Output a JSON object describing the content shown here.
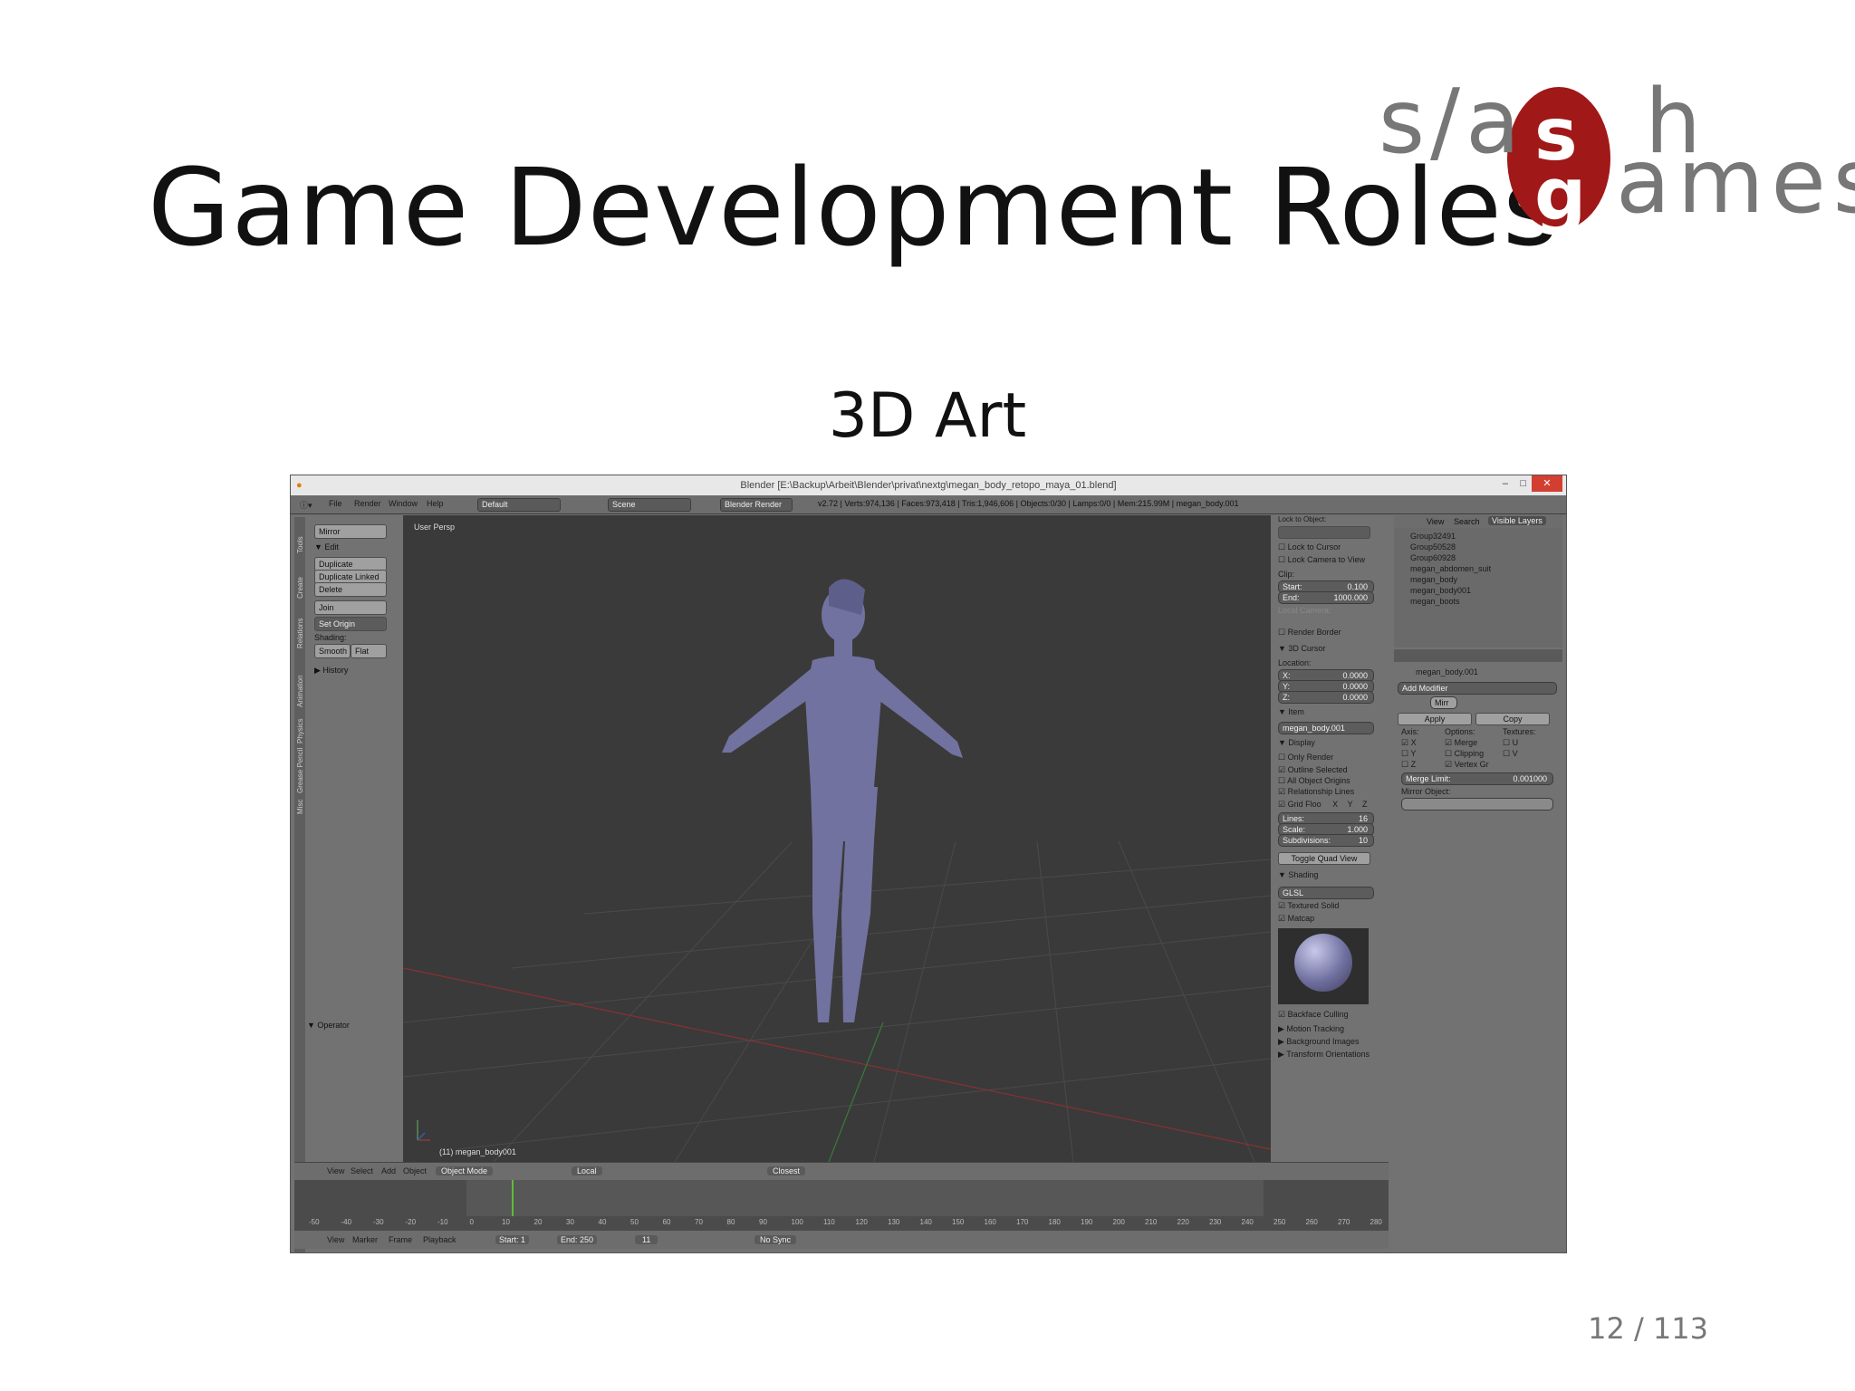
{
  "slide": {
    "title": "Game Development Roles",
    "subtitle": "3D Art",
    "page": "12 / 113",
    "logo": {
      "line1": "s/a",
      "line1b": "h",
      "line2": "ames",
      "mark_top": "s",
      "mark_bottom": "g",
      "mark_color": "#a01818"
    }
  },
  "blender": {
    "window_title": "Blender [E:\\Backup\\Arbeit\\Blender\\privat\\nextg\\megan_body_retopo_maya_01.blend]",
    "menu": [
      "File",
      "Render",
      "Window",
      "Help"
    ],
    "layout": "Default",
    "scene": "Scene",
    "engine": "Blender Render",
    "stats": "v2.72 | Verts:974,136 | Faces:973,418 | Tris:1,946,606 | Objects:0/30 | Lamps:0/0 | Mem:215.99M | megan_body.001",
    "toolshelf": {
      "mirror": "Mirror",
      "edit_header": "▼ Edit",
      "duplicate": "Duplicate",
      "duplicate_linked": "Duplicate Linked",
      "delete": "Delete",
      "join": "Join",
      "set_origin": "Set Origin",
      "shading": "Shading:",
      "smooth": "Smooth",
      "flat": "Flat",
      "history": "▶ History",
      "operator": "▼ Operator",
      "tabs": [
        "Tools",
        "Create",
        "Relations",
        "Animation",
        "Physics",
        "Grease Pencil",
        "Misc"
      ]
    },
    "viewport": {
      "label": "User Persp",
      "object_label": "(11) megan_body001"
    },
    "right_panel": {
      "lock_object": "Lock to Object:",
      "lock_cursor": "Lock to Cursor",
      "lock_camera": "Lock Camera to View",
      "clip": "Clip:",
      "clip_start": "Start:",
      "clip_start_val": "0.100",
      "clip_end": "End:",
      "clip_end_val": "1000.000",
      "local_camera": "Local Camera:",
      "render_border": "Render Border",
      "cursor_header": "▼ 3D Cursor",
      "location": "Location:",
      "x": "X:",
      "x_val": "0.0000",
      "y": "Y:",
      "y_val": "0.0000",
      "z": "Z:",
      "z_val": "0.0000",
      "item_header": "▼ Item",
      "item_name": "megan_body.001",
      "display_header": "▼ Display",
      "only_render": "Only Render",
      "outline_selected": "Outline Selected",
      "all_origins": "All Object Origins",
      "relationship_lines": "Relationship Lines",
      "grid_floor": "Grid Floo",
      "axis_x": "X",
      "axis_y": "Y",
      "axis_z": "Z",
      "lines": "Lines:",
      "lines_val": "16",
      "scale": "Scale:",
      "scale_val": "1.000",
      "subdivisions": "Subdivisions:",
      "subdivisions_val": "10",
      "toggle_quad": "Toggle Quad View",
      "shading_header": "▼ Shading",
      "shading_mode": "GLSL",
      "textured_solid": "Textured Solid",
      "matcap": "Matcap",
      "backface_culling": "Backface Culling",
      "motion_tracking": "▶ Motion Tracking",
      "background_images": "▶ Background Images",
      "transform_orientations": "▶ Transform Orientations"
    },
    "outliner": {
      "tabs": [
        "View",
        "Search",
        "Visible Layers"
      ],
      "items": [
        "Group32491",
        "Group50528",
        "Group60928",
        "megan_abdomen_suit",
        "megan_body",
        "megan_body001",
        "megan_boots"
      ]
    },
    "properties": {
      "object_path": "megan_body.001",
      "add_modifier": "Add Modifier",
      "modifier_name": "Mirr",
      "apply": "Apply",
      "copy": "Copy",
      "axis": "Axis:",
      "options": "Options:",
      "textures": "Textures:",
      "ax_x": "X",
      "ax_y": "Y",
      "ax_z": "Z",
      "merge": "Merge",
      "clipping": "Clipping",
      "vertex_gr": "Vertex Gr",
      "tex_u": "U",
      "tex_v": "V",
      "merge_limit": "Merge Limit:",
      "merge_limit_val": "0.001000",
      "mirror_object": "Mirror Object:"
    },
    "view_header": {
      "items": [
        "View",
        "Select",
        "Add",
        "Object"
      ],
      "mode": "Object Mode",
      "pivot": "Local",
      "snap": "Closest"
    },
    "timeline": {
      "ticks": [
        "-50",
        "-40",
        "-30",
        "-20",
        "-10",
        "0",
        "10",
        "20",
        "30",
        "40",
        "50",
        "60",
        "70",
        "80",
        "90",
        "100",
        "110",
        "120",
        "130",
        "140",
        "150",
        "160",
        "170",
        "180",
        "190",
        "200",
        "210",
        "220",
        "230",
        "240",
        "250",
        "260",
        "270",
        "280"
      ],
      "menu": [
        "View",
        "Marker",
        "Frame",
        "Playback"
      ],
      "start": "Start:",
      "start_val": "1",
      "end": "End:",
      "end_val": "250",
      "current": "11",
      "sync": "No Sync"
    }
  }
}
